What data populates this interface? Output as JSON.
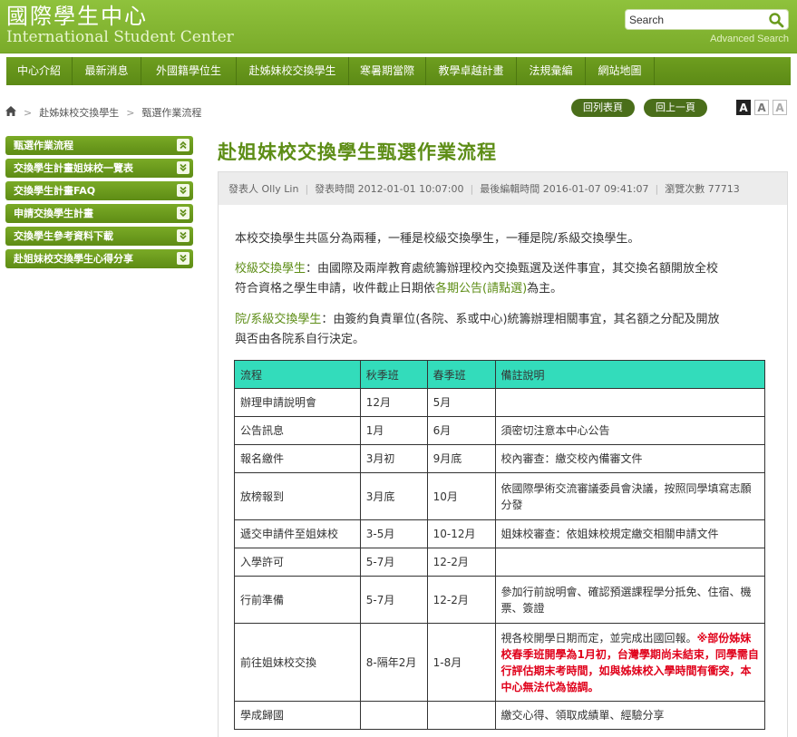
{
  "header": {
    "title": "國際學生中心",
    "subtitle": "International Student Center",
    "search_placeholder": "Search",
    "advanced_search": "Advanced Search"
  },
  "nav": {
    "items": [
      "中心介紹",
      "最新消息",
      "外國籍學位生",
      "赴姊妹校交換學生",
      "寒暑期當際",
      "教學卓越計畫",
      "法規彙編",
      "網站地圖"
    ]
  },
  "breadcrumb": {
    "items": [
      "赴姊妹校交換學生",
      "甄選作業流程"
    ]
  },
  "toolbar": {
    "print_label": "回列表頁",
    "back_label": "回上一頁",
    "font_large": "A",
    "font_medium": "A",
    "font_small": "A"
  },
  "sidebar": {
    "items": [
      {
        "label": "甄選作業流程"
      },
      {
        "label": "交換學生計畫姐妹校一覽表"
      },
      {
        "label": "交換學生計畫FAQ"
      },
      {
        "label": "申請交換學生計畫"
      },
      {
        "label": "交換學生參考資料下載"
      },
      {
        "label": "赴姐妹校交換學生心得分享"
      }
    ]
  },
  "article": {
    "title": "赴姐妹校交換學生甄選作業流程",
    "meta": {
      "author_label": "發表人",
      "author": "Olly Lin",
      "posted_label": "發表時間",
      "posted": "2012-01-01 10:07:00",
      "edited_label": "最後編輯時間",
      "edited": "2016-01-07 09:41:07",
      "views_label": "瀏覽次數",
      "views": "77713"
    },
    "intro": "本校交換學生共區分為兩種，一種是校級交換學生，一種是院/系級交換學生。",
    "school_level": {
      "heading": "校級交換學生",
      "text1": "：由國際及兩岸教育處統籌辦理校內交換甄選及送件事宜，其交換名額開放全校",
      "text2": "符合資格之學生申請，收件截止日期依",
      "link": "各期公告(請點選)",
      "text3": "為主。"
    },
    "dept_level": {
      "heading": "院/系級交換學生",
      "text1": "：由簽約負責單位(各院、系或中心)統籌辦理相關事宜，其名額之分配及開放",
      "text2": "與否由各院系自行決定。"
    }
  },
  "table": {
    "headers": [
      "流程",
      "秋季班",
      "春季班",
      "備註說明"
    ],
    "rows": [
      [
        "辦理申請說明會",
        "12月",
        "5月",
        ""
      ],
      [
        "公告訊息",
        "1月",
        "6月",
        "須密切注意本中心公告"
      ],
      [
        "報名繳件",
        "3月初",
        "9月底",
        "校內審查：繳交校內備審文件"
      ],
      [
        "放榜報到",
        "3月底",
        "10月",
        "依國際學術交流審議委員會決議，按照同學填寫志願分發"
      ],
      [
        "遞交申請件至姐妹校",
        "3-5月",
        "10-12月",
        "姐妹校審查：依姐妹校規定繳交相關申請文件"
      ],
      [
        "入學許可",
        "5-7月",
        "12-2月",
        ""
      ],
      [
        "行前準備",
        "5-7月",
        "12-2月",
        "參加行前說明會、確認預選課程學分抵免、住宿、機票、簽證"
      ],
      [
        "前往姐妹校交換",
        "8-隔年2月",
        "1-8月",
        ""
      ],
      [
        "學成歸國",
        "",
        "",
        "繳交心得、領取成績單、經驗分享"
      ]
    ],
    "row8_note_normal": "視各校開學日期而定，並完成出國回報。",
    "row8_note_red": "※部份姊妹校春季班開學為1月初，台灣學期尚未結束，同學需自行評估期末考時間，如與姊妹校入學時間有衝突，本中心無法代為協調。"
  },
  "colors": {
    "brand_green": "#7aab2a",
    "nav_green": "#5c8a16",
    "title_green": "#5d8d16",
    "table_header": "#33dcbb",
    "alert_red": "#e0001a"
  }
}
